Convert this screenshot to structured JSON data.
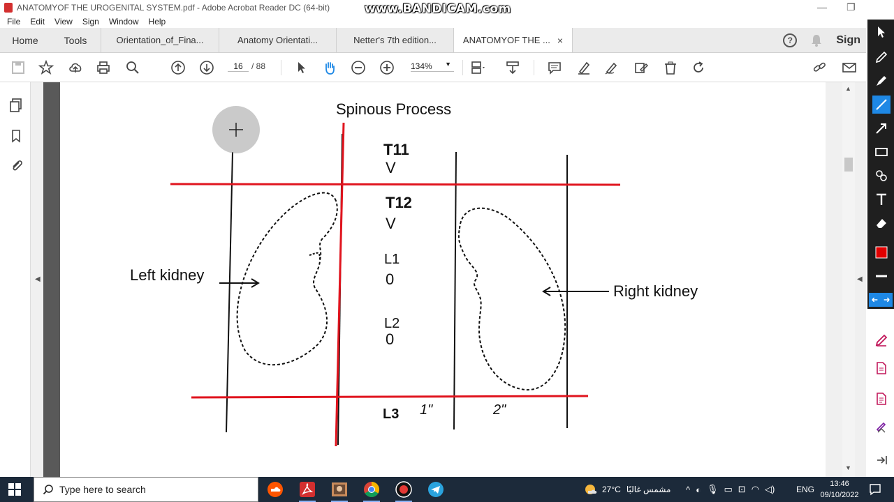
{
  "window": {
    "title": "ANATOMYOF THE UROGENITAL SYSTEM.pdf - Adobe Acrobat Reader DC (64-bit)",
    "watermark": "www.BANDICAM.com"
  },
  "menu": [
    "File",
    "Edit",
    "View",
    "Sign",
    "Window",
    "Help"
  ],
  "tabs": {
    "home": "Home",
    "tools": "Tools",
    "docs": [
      "Orientation_of_Fina...",
      "Anatomy Orientati...",
      "Netter's 7th edition...",
      "ANATOMYOF THE ..."
    ],
    "active_index": 3,
    "close": "×",
    "sign": "Sign"
  },
  "toolbar": {
    "page_current": "16",
    "page_total": "/ 88",
    "zoom": "134%"
  },
  "figure": {
    "title": "Spinous Process",
    "left_label": "Left kidney",
    "right_label": "Right kidney",
    "vertebrae": [
      "T11",
      "T12",
      "L1",
      "L2",
      "L3"
    ],
    "measures": [
      "1\"",
      "2\""
    ],
    "annotation_color": "#e0141e"
  },
  "taskbar": {
    "search_placeholder": "Type here to search",
    "weather": "27°C",
    "weather_text": "مشمس غالبًا",
    "lang": "ENG",
    "time": "13:46",
    "date": "09/10/2022"
  },
  "colors": {
    "accent": "#1e88e5",
    "red_tool": "#e00000"
  }
}
